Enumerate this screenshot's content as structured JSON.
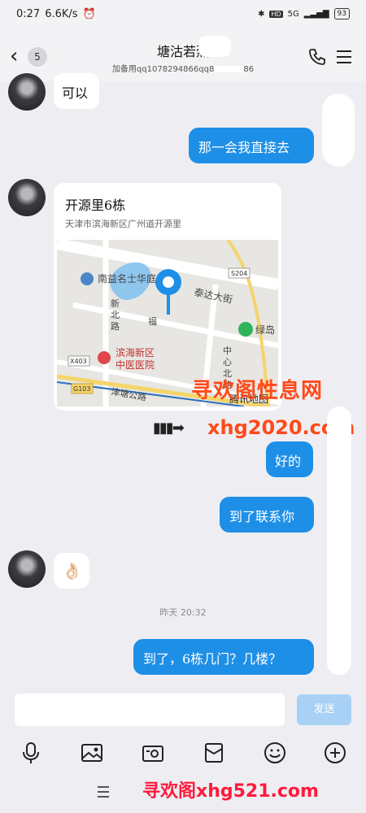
{
  "status_bar": {
    "time": "0:27",
    "speed": "6.6K/s",
    "network": "5G",
    "battery": "93"
  },
  "header": {
    "unread_count": "5",
    "title": "塘沽若烈",
    "subtitle": "加备用qq1078294866qq8",
    "subtitle_tail": "86"
  },
  "messages": [
    {
      "side": "left",
      "text": "可以"
    },
    {
      "side": "right",
      "text": "那一会我直接去"
    },
    {
      "side": "left",
      "type": "location"
    },
    {
      "side": "right",
      "text": "好的"
    },
    {
      "side": "right",
      "text": "到了联系你"
    },
    {
      "side": "left",
      "text": "👌🏻"
    },
    {
      "side": "right",
      "text": "到了，6栋几门？几楼？"
    }
  ],
  "location_card": {
    "name": "开源里6栋",
    "address": "天津市滨海新区广州道开源里",
    "map_labels": {
      "poi1": "南益名士华庭",
      "road1": "泰达大街",
      "road_badge1": "S204",
      "poi2": "绿岛",
      "road2_a": "新",
      "road2_b": "北",
      "road2_c": "路",
      "road3": "福",
      "road_badge2": "X403",
      "poi3_a": "滨海新区",
      "poi3_b": "中医医院",
      "road4_a": "中",
      "road4_b": "心",
      "road4_c": "北",
      "road4_d": "路",
      "road_badge3": "G103",
      "road5": "津塘公路",
      "provider": "腾讯地图"
    }
  },
  "time_label": "昨天 20:32",
  "input": {
    "placeholder": "",
    "send_label": "发送"
  },
  "watermarks": {
    "line1": "寻欢阁性息网",
    "line2": "xhg2020.com",
    "line3": "寻欢阁xhg521.com"
  },
  "colors": {
    "bubble_right": "#1e8fe6",
    "watermark": "#ff4a1a",
    "send_disabled": "#a9d1f5"
  }
}
